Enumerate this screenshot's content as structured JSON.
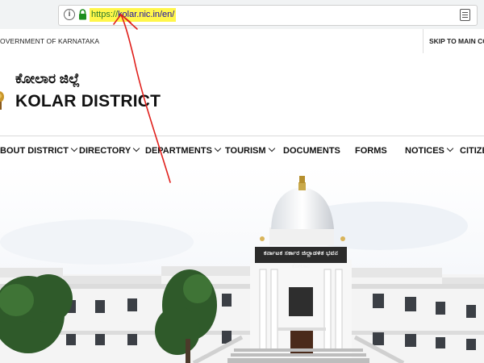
{
  "browser": {
    "url_protocol": "https://",
    "url_rest": "kolar.nic.in/en/",
    "info_icon": "info-icon",
    "lock_icon": "lock-icon",
    "reader_icon": "reader-mode-icon",
    "highlight_color": "#fff64a"
  },
  "gov_strip": {
    "label": "OVERNMENT OF KARNATAKA",
    "skip_link": "SKIP TO MAIN CO"
  },
  "header": {
    "title_kannada": "ಕೋಲಾರ ಜಿಲ್ಲೆ",
    "title_english": "KOLAR DISTRICT"
  },
  "nav": {
    "items": [
      {
        "label": "BOUT DISTRICT",
        "dropdown": true
      },
      {
        "label": "DIRECTORY",
        "dropdown": true
      },
      {
        "label": "DEPARTMENTS",
        "dropdown": true
      },
      {
        "label": "TOURISM",
        "dropdown": true
      },
      {
        "label": "DOCUMENTS",
        "dropdown": false
      },
      {
        "label": "FORMS",
        "dropdown": false
      },
      {
        "label": "NOTICES",
        "dropdown": true
      },
      {
        "label": "CITIZE",
        "dropdown": false
      }
    ]
  },
  "hero": {
    "building_banner": "ಕರ್ನಾಟಕ ಸರ್ಕಾರ ಜಿಲ್ಲಾಡಳಿತ ಭವನ ಕೋಲಾರ"
  },
  "annotation": {
    "color": "#e0201c"
  }
}
